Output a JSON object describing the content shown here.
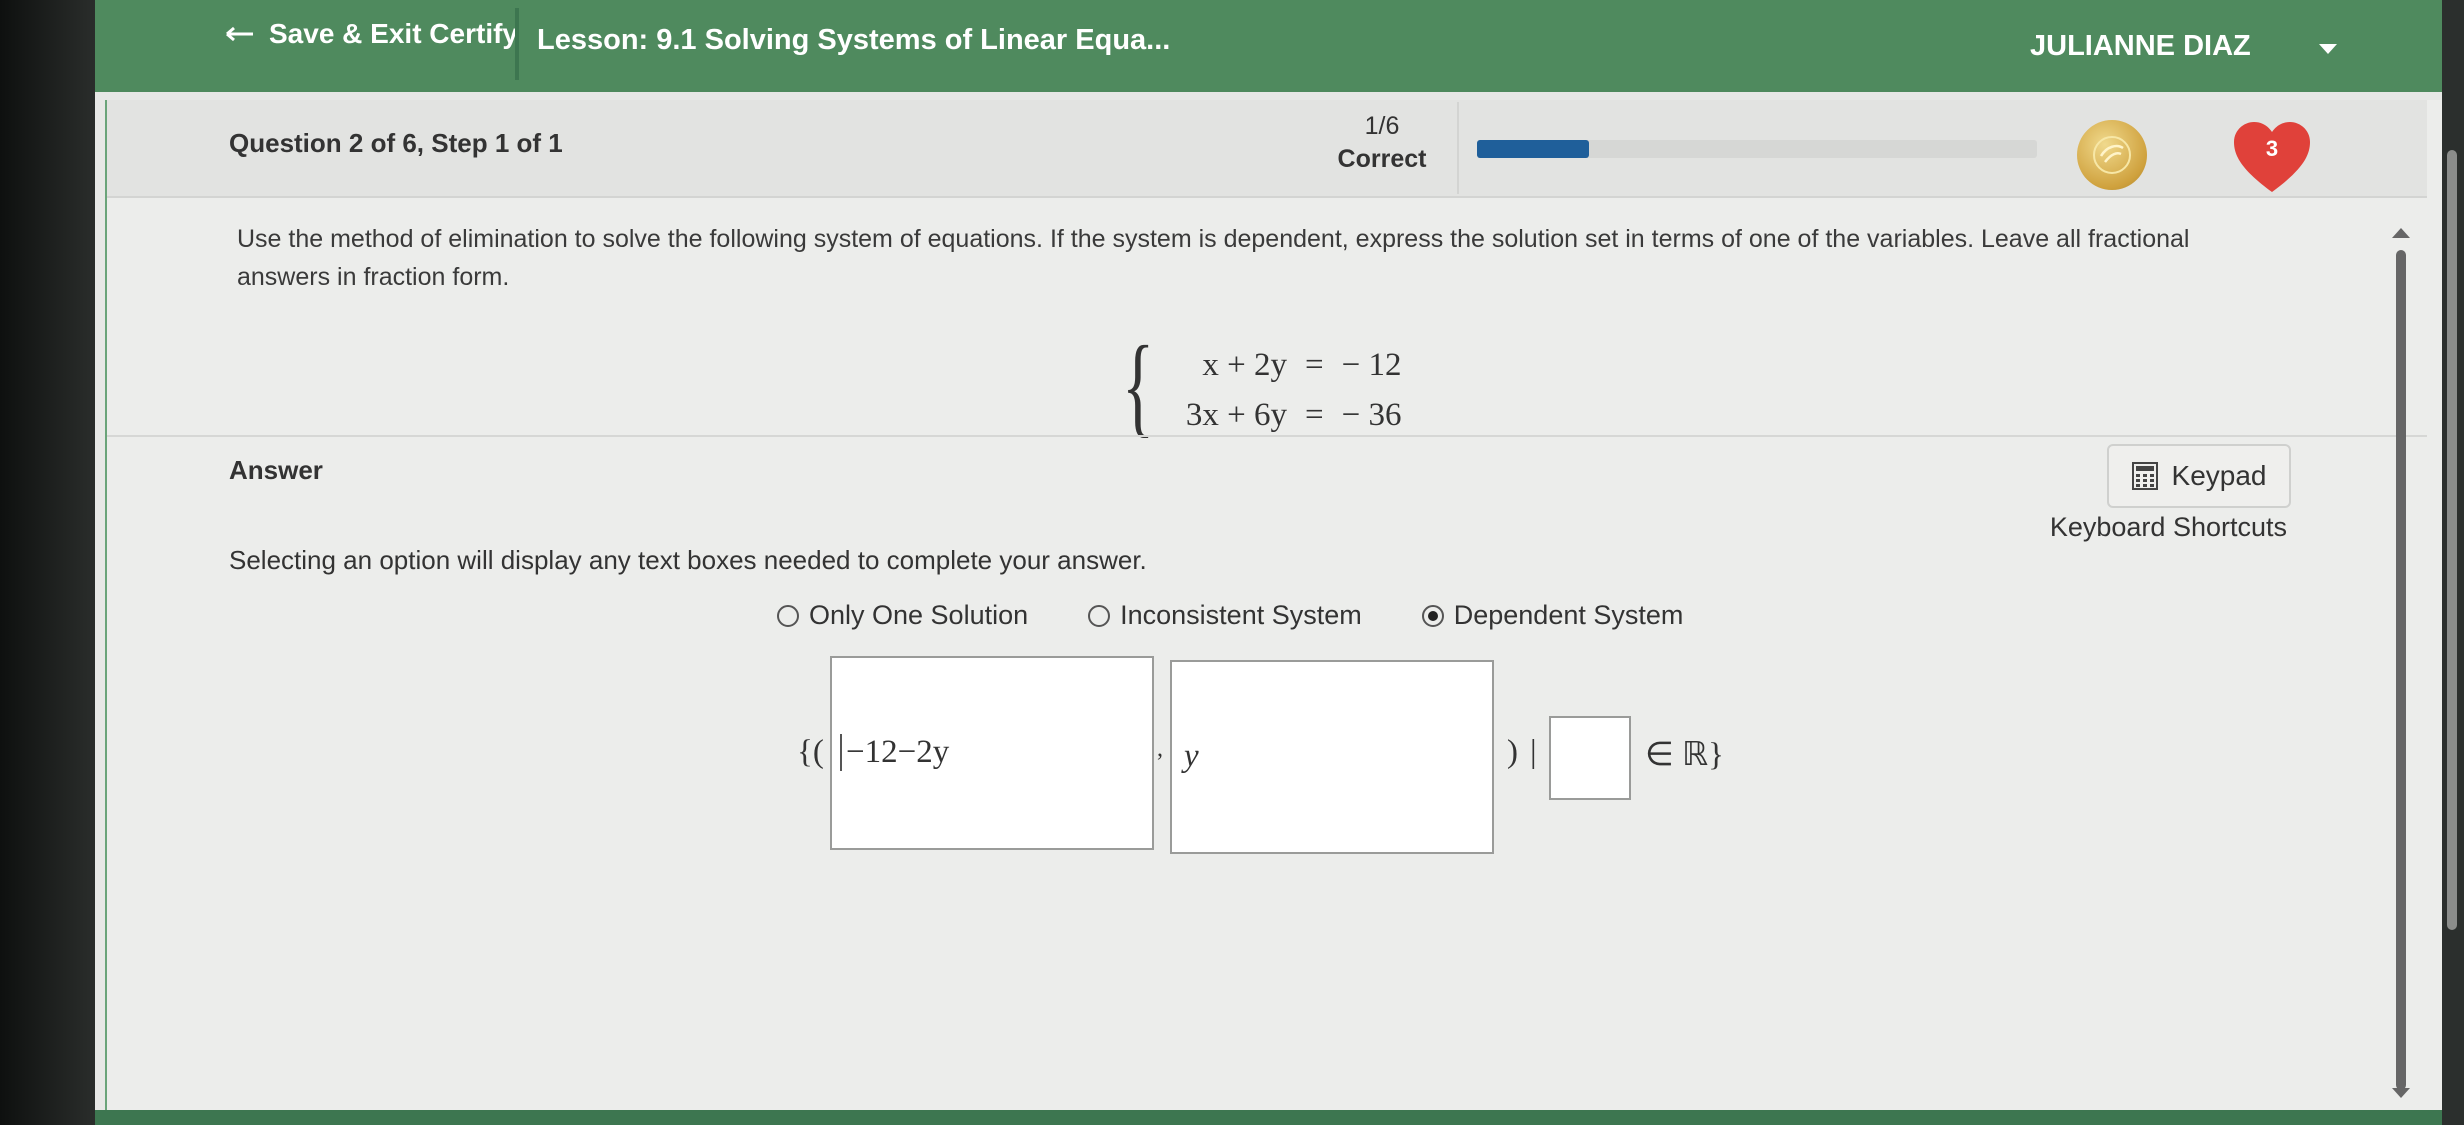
{
  "topbar": {
    "back_label": "Save & Exit Certify",
    "lesson_title": "Lesson: 9.1 Solving Systems of Linear Equa...",
    "user_name": "JULIANNE DIAZ"
  },
  "question": {
    "title": "Question 2 of 6, Step 1 of 1",
    "score_fraction": "1/6",
    "score_status": "Correct",
    "progress_fraction": 0.2,
    "hearts": "3",
    "prompt": "Use the method of elimination to solve the following system of equations. If the system is dependent, express the solution set in terms of one of the variables. Leave all fractional answers in fraction form.",
    "equations": [
      {
        "lhs": "x + 2y",
        "rel": "=",
        "rhs": "− 12"
      },
      {
        "lhs": "3x + 6y",
        "rel": "=",
        "rhs": "− 36"
      }
    ]
  },
  "answer": {
    "label": "Answer",
    "keypad_label": "Keypad",
    "shortcuts_label": "Keyboard Shortcuts",
    "select_message": "Selecting an option will display any text boxes needed to complete your answer.",
    "options": [
      {
        "label": "Only One Solution",
        "selected": false
      },
      {
        "label": "Inconsistent System",
        "selected": false
      },
      {
        "label": "Dependent System",
        "selected": true
      }
    ],
    "set_open": "{(",
    "first_value": "−12−2y",
    "comma": ",",
    "second_value": "y",
    "close_paren": ")",
    "bar": "|",
    "third_value": "",
    "set_close": "∈ ℝ}"
  },
  "colors": {
    "header_green": "#4f8a5e",
    "progress_blue": "#1f5f9a",
    "heart_red": "#e0413a",
    "coin_gold": "#cfa13d"
  }
}
